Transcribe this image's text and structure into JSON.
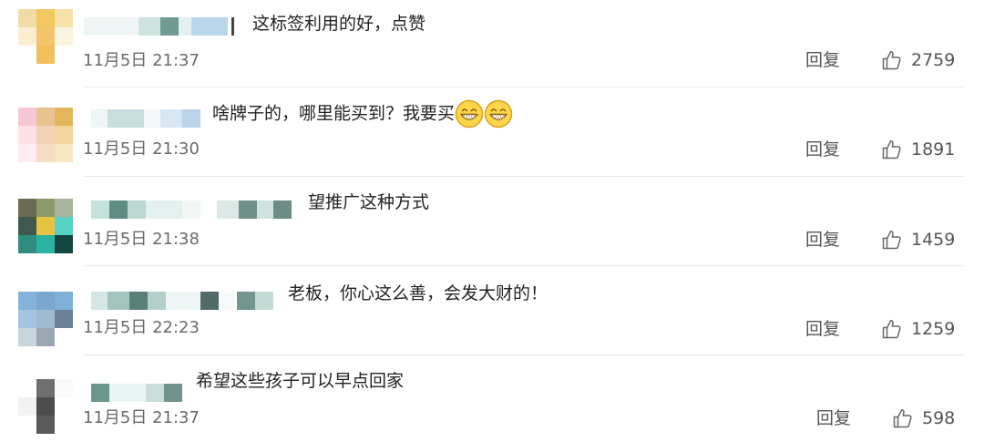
{
  "reply_label": "回复",
  "colors": {
    "text": "#222222",
    "meta": "#6a6a6a",
    "divider": "#e9e9e9"
  },
  "comments": [
    {
      "text": "这标签利用的好，点赞",
      "time": "11月5日 21:37",
      "likes": "2759"
    },
    {
      "text": "啥牌子的，哪里能买到？我要买",
      "time": "11月5日 21:30",
      "likes": "1891",
      "emoji": "grinning-face-icon x2"
    },
    {
      "text": "望推广这种方式",
      "time": "11月5日 21:38",
      "likes": "1459"
    },
    {
      "text": "老板，你心这么善，会发大财的！",
      "time": "11月5日 22:23",
      "likes": "1259"
    },
    {
      "text": "希望这些孩子可以早点回家",
      "time": "11月5日 21:37",
      "likes": "598"
    }
  ]
}
